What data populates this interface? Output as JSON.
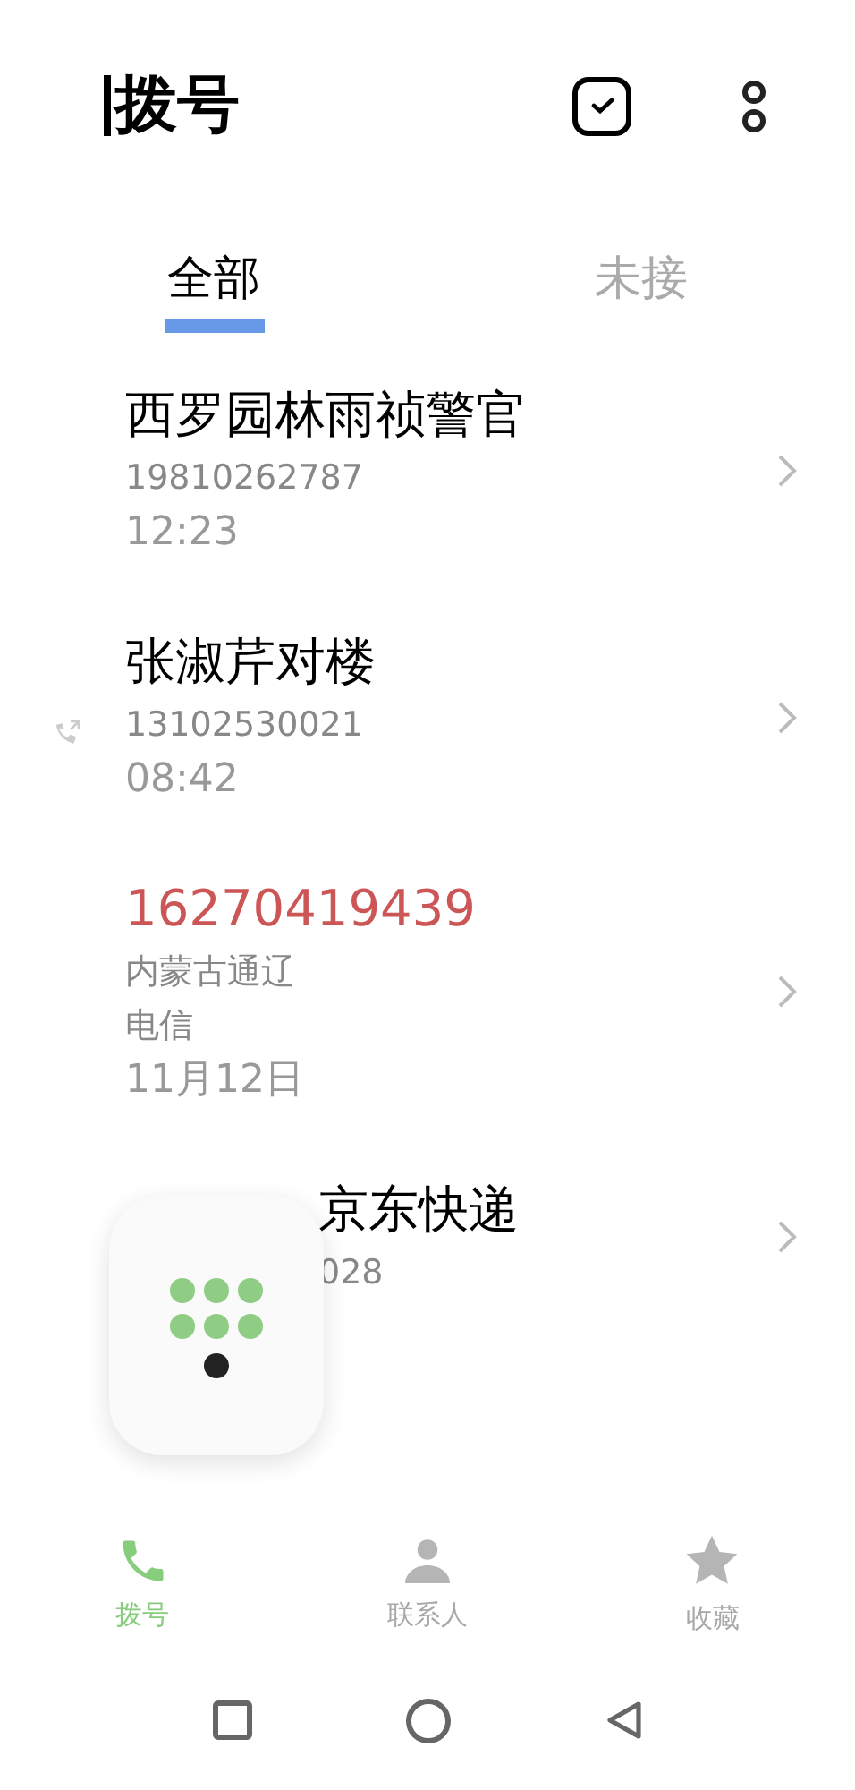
{
  "header": {
    "title": "拨号"
  },
  "tabs": [
    {
      "label": "全部",
      "selected": true
    },
    {
      "label": "未接",
      "selected": false
    }
  ],
  "calls": [
    {
      "name": "西罗园林雨祯警官",
      "details": [
        "19810262787"
      ],
      "time": "12:23",
      "missed": false,
      "outgoing": false,
      "covered": false
    },
    {
      "name": "张淑芹对楼",
      "details": [
        "13102530021"
      ],
      "time": "08:42",
      "missed": false,
      "outgoing": true,
      "covered": false
    },
    {
      "name": "16270419439",
      "details": [
        "内蒙古通辽",
        "电信"
      ],
      "time": "11月12日",
      "missed": true,
      "outgoing": false,
      "covered": false
    },
    {
      "name": "京东快递",
      "details": [
        "028"
      ],
      "missed": false,
      "outgoing": false,
      "covered": true
    }
  ],
  "bottom_nav": [
    {
      "label": "拨号",
      "kind": "phone",
      "selected": true
    },
    {
      "label": "联系人",
      "kind": "person",
      "selected": false
    },
    {
      "label": "收藏",
      "kind": "star",
      "selected": false
    }
  ]
}
